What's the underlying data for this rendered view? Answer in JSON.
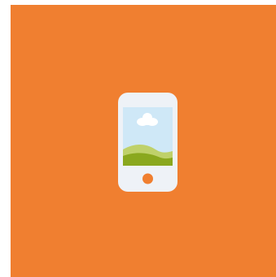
{
  "background": {
    "color": "#f07f30"
  },
  "icon": {
    "name": "smartphone-landscape-icon",
    "body_color": "#eef2f7",
    "sky_color": "#cfe8f7",
    "cloud_color": "#ffffff",
    "hill_color": "#8aa81e",
    "hill_back_color": "#bfd16a",
    "home_button_color": "#f07f30"
  }
}
